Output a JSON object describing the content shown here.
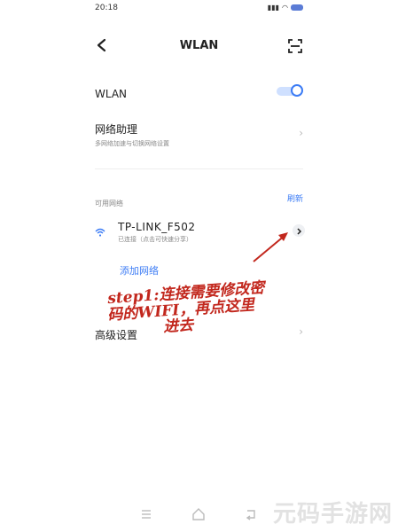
{
  "status_bar": {
    "time": "20:18",
    "battery": "62"
  },
  "header": {
    "title": "WLAN"
  },
  "wlan_toggle": {
    "label": "WLAN",
    "on": true
  },
  "assistant": {
    "title": "网络助理",
    "subtitle": "多网络加速与切换网络设置"
  },
  "networks": {
    "section_label": "可用网络",
    "refresh": "刷新",
    "items": [
      {
        "name": "TP-LINK_F502",
        "status": "已连接（点击可快速分享）"
      }
    ]
  },
  "add_network": "添加网络",
  "annotation": {
    "line1": "step1:连接需要修改密",
    "line2": "码的WIFI，再点这里",
    "line3": "进去"
  },
  "advanced": {
    "label": "高级设置"
  },
  "watermark": "元码手游网",
  "colors": {
    "accent": "#3c7cf5",
    "annotation": "#c2271d"
  }
}
